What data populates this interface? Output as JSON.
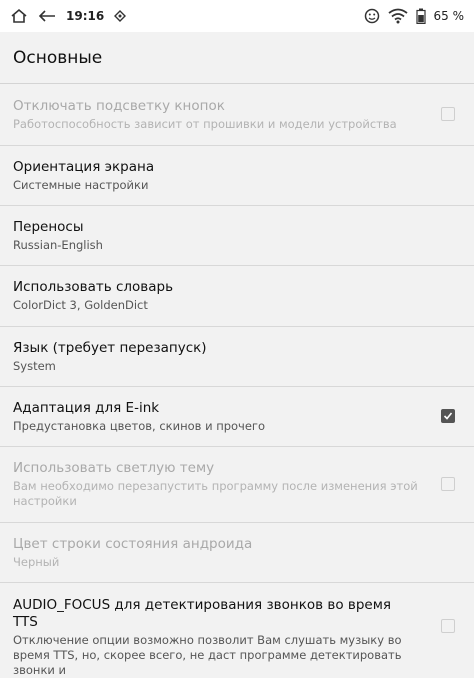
{
  "status_bar": {
    "time": "19:16",
    "battery_percent": "65 %",
    "icons": [
      "home-icon",
      "back-arrow-icon",
      "sync-icon",
      "face-icon",
      "wifi-icon",
      "battery-icon"
    ]
  },
  "header": {
    "title": "Основные"
  },
  "settings": [
    {
      "title": "Отключать подсветку кнопок",
      "summary": "Работоспособность зависит от прошивки и модели устройства",
      "disabled": true,
      "checkbox": true,
      "checked": false
    },
    {
      "title": "Ориентация экрана",
      "summary": "Системные настройки",
      "disabled": false,
      "checkbox": false
    },
    {
      "title": "Переносы",
      "summary": "Russian-English",
      "disabled": false,
      "checkbox": false
    },
    {
      "title": "Использовать словарь",
      "summary": "ColorDict 3, GoldenDict",
      "disabled": false,
      "checkbox": false
    },
    {
      "title": "Язык (требует перезапуск)",
      "summary": "System",
      "disabled": false,
      "checkbox": false
    },
    {
      "title": "Адаптация для E-ink",
      "summary": "Предустановка цветов, скинов и прочего",
      "disabled": false,
      "checkbox": true,
      "checked": true
    },
    {
      "title": "Использовать светлую тему",
      "summary": "Вам необходимо перезапустить программу после изменения этой настройки",
      "disabled": true,
      "checkbox": true,
      "checked": false
    },
    {
      "title": "Цвет строки состояния андроида",
      "summary": "Черный",
      "disabled": true,
      "checkbox": false
    },
    {
      "title": "AUDIO_FOCUS для детектирования звонков во время TTS",
      "summary": "Отключение опции возможно позволит Вам слушать музыку во время TTS, но, скорее всего, не даст программе детектировать звонки и",
      "disabled": false,
      "checkbox": true,
      "checked": false
    }
  ]
}
